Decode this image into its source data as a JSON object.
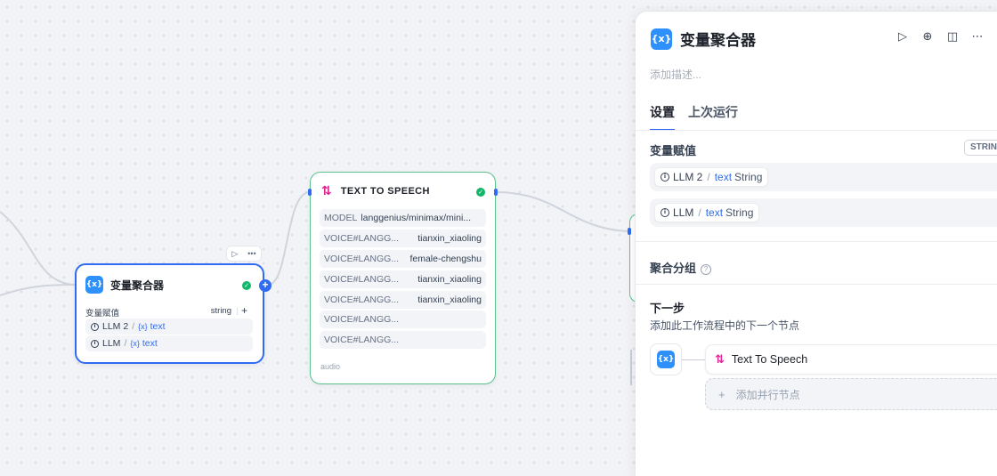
{
  "canvas": {
    "aggregator_node": {
      "icon": "variable-icon",
      "icon_text": "{x}",
      "title": "变量聚合器",
      "field_label": "变量赋值",
      "field_type": "string",
      "add_symbol": "+",
      "vars": [
        {
          "node": "LLM 2",
          "var_icon": "{x}",
          "var": "text"
        },
        {
          "node": "LLM",
          "var_icon": "{x}",
          "var": "text"
        }
      ],
      "toolbar": {
        "run_symbol": "▷",
        "more_symbol": "•••"
      }
    },
    "tts_node": {
      "icon": "text-to-speech-icon",
      "title": "TEXT TO SPEECH",
      "rows": [
        {
          "key": "MODEL",
          "value": "langgenius/minimax/mini..."
        },
        {
          "key": "VOICE#LANGG...",
          "value": "tianxin_xiaoling"
        },
        {
          "key": "VOICE#LANGG...",
          "value": "female-chengshu"
        },
        {
          "key": "VOICE#LANGG...",
          "value": "tianxin_xiaoling"
        },
        {
          "key": "VOICE#LANGG...",
          "value": "tianxin_xiaoling"
        },
        {
          "key": "VOICE#LANGG...",
          "value": ""
        },
        {
          "key": "VOICE#LANGG...",
          "value": ""
        }
      ],
      "footer": "audio"
    }
  },
  "panel": {
    "icon_text": "{x}",
    "title": "变量聚合器",
    "actions": [
      "run-icon",
      "locate-icon",
      "split-view-icon",
      "more-icon"
    ],
    "description_placeholder": "添加描述...",
    "tabs": [
      {
        "label": "设置",
        "active": true
      },
      {
        "label": "上次运行",
        "active": false
      }
    ],
    "assign": {
      "label": "变量赋值",
      "type_tag": "STRING",
      "vars": [
        {
          "node": "LLM 2",
          "var": "text",
          "type": "String"
        },
        {
          "node": "LLM",
          "var": "text",
          "type": "String"
        }
      ]
    },
    "group": {
      "label": "聚合分组",
      "help": "?"
    },
    "next": {
      "title": "下一步",
      "desc": "添加此工作流程中的下一个节点",
      "target": "Text To Speech",
      "add_parallel": "添加并行节点"
    }
  },
  "colors": {
    "accent": "#2f6cf3",
    "success": "#12b76a",
    "tts_border": "#5cc08d",
    "tts_icon": "#dd2590"
  }
}
